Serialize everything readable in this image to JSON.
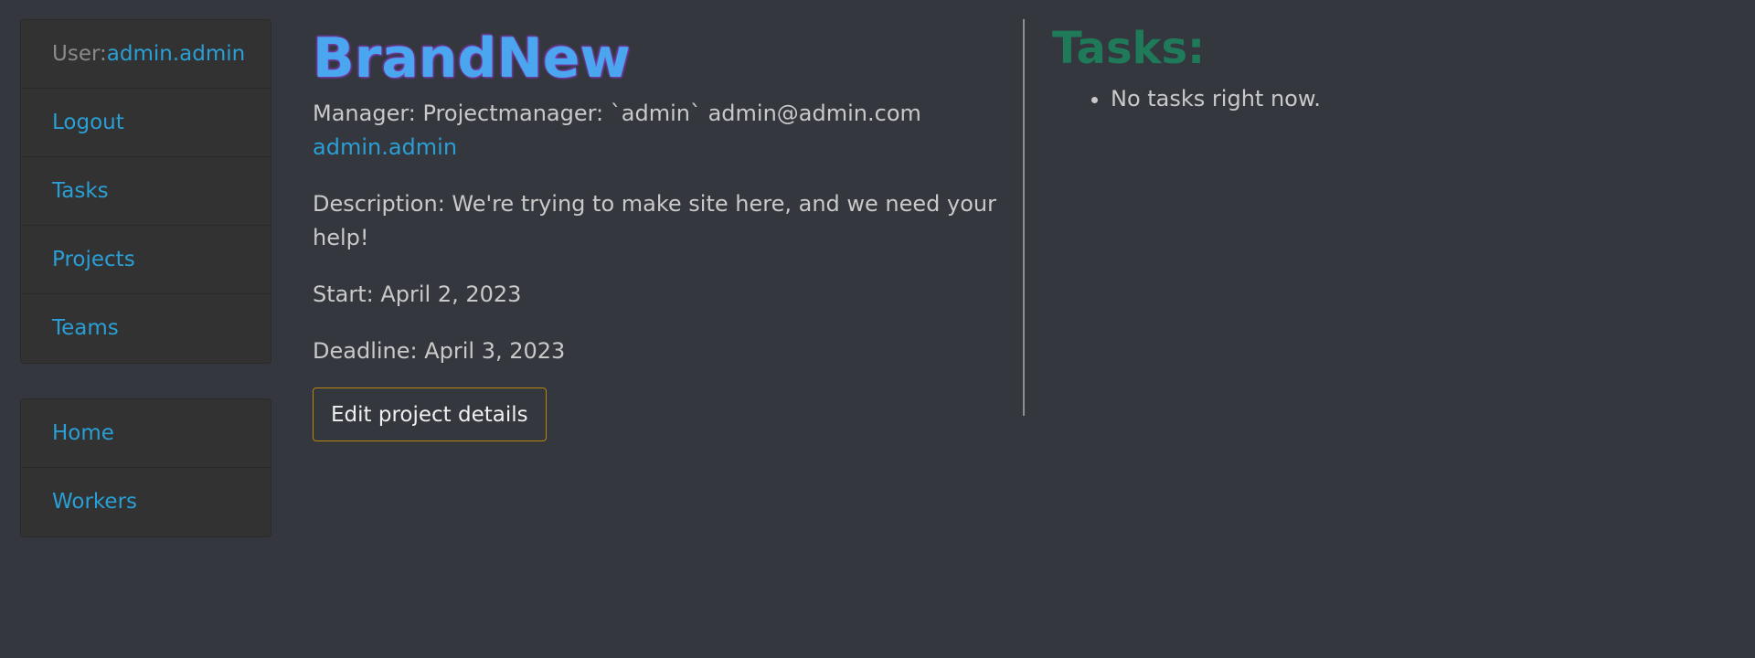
{
  "sidebar": {
    "user_label": "User:",
    "username": "admin.admin",
    "primary_items": [
      {
        "label": "Logout"
      },
      {
        "label": "Tasks"
      },
      {
        "label": "Projects"
      },
      {
        "label": "Teams"
      }
    ],
    "secondary_items": [
      {
        "label": "Home"
      },
      {
        "label": "Workers"
      }
    ]
  },
  "project": {
    "title": "BrandNew",
    "manager_text": "Manager: Projectmanager: `admin` admin@admin.com",
    "manager_link": "admin.admin",
    "description": "Description: We're trying to make site here, and we need your help!",
    "start": "Start: April 2, 2023",
    "deadline": "Deadline: April 3, 2023",
    "edit_button": "Edit project details"
  },
  "tasks": {
    "title": "Tasks:",
    "items": [
      {
        "label": "No tasks right now."
      }
    ]
  },
  "colors": {
    "background": "#34373d",
    "link": "#2a9fd6",
    "title": "#4aa7ef",
    "title_glow": "#8b3fd1",
    "tasks_title": "#1f7a5a",
    "button_border": "#b8860b"
  }
}
